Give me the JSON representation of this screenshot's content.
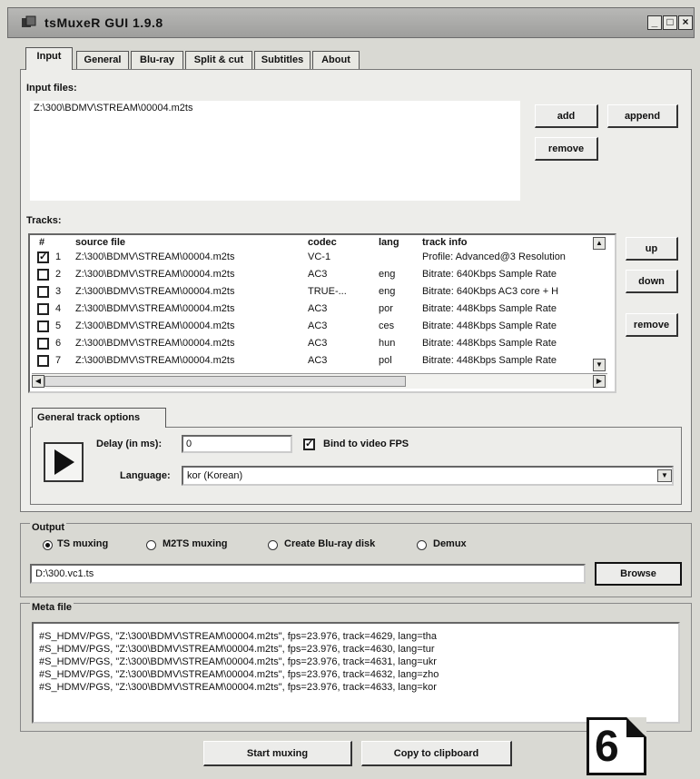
{
  "window": {
    "title": "tsMuxeR GUI 1.9.8",
    "min": "_",
    "max": "□",
    "close": "×"
  },
  "tabs": [
    "Input",
    "General",
    "Blu-ray",
    "Split & cut",
    "Subtitles",
    "About"
  ],
  "input": {
    "files_label": "Input files:",
    "files": [
      "Z:\\300\\BDMV\\STREAM\\00004.m2ts"
    ],
    "add": "add",
    "append": "append",
    "remove": "remove"
  },
  "tracks": {
    "label": "Tracks:",
    "columns": [
      "#",
      "source file",
      "codec",
      "lang",
      "track info"
    ],
    "rows": [
      {
        "n": "1",
        "checked": true,
        "file": "Z:\\300\\BDMV\\STREAM\\00004.m2ts",
        "codec": "VC-1",
        "lang": "",
        "info": "Profile: Advanced@3 Resolution"
      },
      {
        "n": "2",
        "checked": false,
        "file": "Z:\\300\\BDMV\\STREAM\\00004.m2ts",
        "codec": "AC3",
        "lang": "eng",
        "info": "Bitrate: 640Kbps Sample Rate"
      },
      {
        "n": "3",
        "checked": false,
        "file": "Z:\\300\\BDMV\\STREAM\\00004.m2ts",
        "codec": "TRUE-...",
        "lang": "eng",
        "info": "Bitrate: 640Kbps AC3 core + H"
      },
      {
        "n": "4",
        "checked": false,
        "file": "Z:\\300\\BDMV\\STREAM\\00004.m2ts",
        "codec": "AC3",
        "lang": "por",
        "info": "Bitrate: 448Kbps Sample Rate"
      },
      {
        "n": "5",
        "checked": false,
        "file": "Z:\\300\\BDMV\\STREAM\\00004.m2ts",
        "codec": "AC3",
        "lang": "ces",
        "info": "Bitrate: 448Kbps Sample Rate"
      },
      {
        "n": "6",
        "checked": false,
        "file": "Z:\\300\\BDMV\\STREAM\\00004.m2ts",
        "codec": "AC3",
        "lang": "hun",
        "info": "Bitrate: 448Kbps Sample Rate"
      },
      {
        "n": "7",
        "checked": false,
        "file": "Z:\\300\\BDMV\\STREAM\\00004.m2ts",
        "codec": "AC3",
        "lang": "pol",
        "info": "Bitrate: 448Kbps Sample Rate"
      }
    ],
    "up": "up",
    "down": "down",
    "remove": "remove"
  },
  "track_options": {
    "tab": "General track options",
    "delay_label": "Delay (in ms):",
    "delay_value": "0",
    "bind_fps_label": "Bind to video FPS",
    "bind_fps_checked": true,
    "language_label": "Language:",
    "language_value": "kor (Korean)"
  },
  "output": {
    "label": "Output",
    "modes": [
      {
        "label": "TS muxing",
        "selected": true
      },
      {
        "label": "M2TS muxing",
        "selected": false
      },
      {
        "label": "Create Blu-ray disk",
        "selected": false
      },
      {
        "label": "Demux",
        "selected": false
      }
    ],
    "path": "D:\\300.vc1.ts",
    "browse": "Browse"
  },
  "meta": {
    "label": "Meta file",
    "lines": [
      "#S_HDMV/PGS, \"Z:\\300\\BDMV\\STREAM\\00004.m2ts\", fps=23.976, track=4629, lang=tha",
      "#S_HDMV/PGS, \"Z:\\300\\BDMV\\STREAM\\00004.m2ts\", fps=23.976, track=4630, lang=tur",
      "#S_HDMV/PGS, \"Z:\\300\\BDMV\\STREAM\\00004.m2ts\", fps=23.976, track=4631, lang=ukr",
      "#S_HDMV/PGS, \"Z:\\300\\BDMV\\STREAM\\00004.m2ts\", fps=23.976, track=4632, lang=zho",
      "#S_HDMV/PGS, \"Z:\\300\\BDMV\\STREAM\\00004.m2ts\", fps=23.976, track=4633, lang=kor"
    ]
  },
  "actions": {
    "start": "Start muxing",
    "copy": "Copy to clipboard"
  },
  "badge": {
    "number": "6"
  }
}
